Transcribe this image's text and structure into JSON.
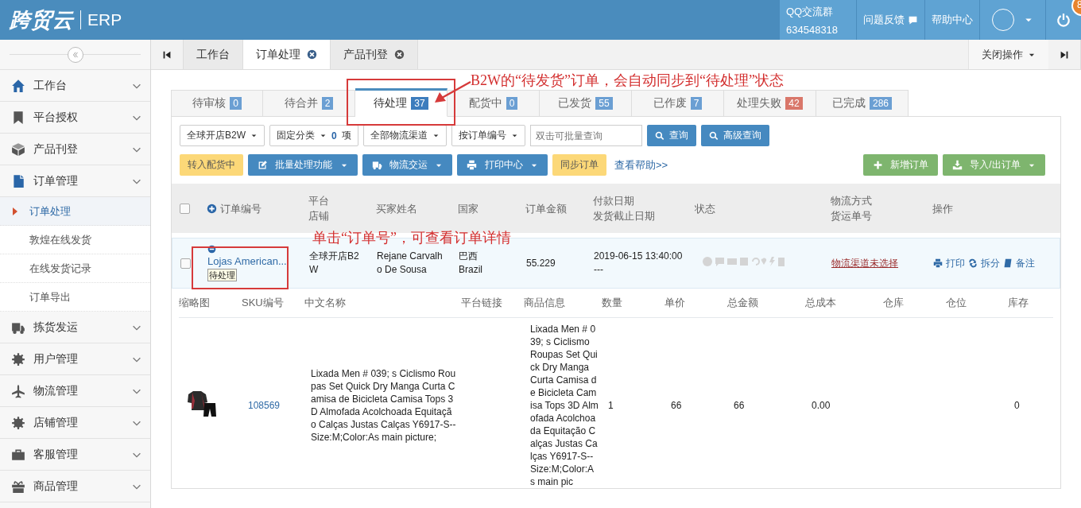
{
  "header": {
    "logo": "跨贸云",
    "product": "ERP",
    "qq_label": "QQ交流群",
    "qq_number": "634548318",
    "feedback": "问题反馈",
    "help": "帮助中心",
    "badge": "8"
  },
  "sidebar": {
    "items": [
      {
        "label": "工作台"
      },
      {
        "label": "平台授权"
      },
      {
        "label": "产品刊登"
      },
      {
        "label": "订单管理",
        "children": [
          {
            "label": "订单处理",
            "selected": true
          },
          {
            "label": "敦煌在线发货",
            "selected": false
          },
          {
            "label": "在线发货记录",
            "selected": false
          },
          {
            "label": "订单导出",
            "selected": false
          }
        ]
      },
      {
        "label": "拣货发运"
      },
      {
        "label": "用户管理"
      },
      {
        "label": "物流管理"
      },
      {
        "label": "店铺管理"
      },
      {
        "label": "客服管理"
      },
      {
        "label": "商品管理"
      }
    ]
  },
  "page_tabs": {
    "tabs": [
      {
        "label": "工作台",
        "selected": false,
        "closable": false
      },
      {
        "label": "订单处理",
        "selected": true,
        "closable": true
      },
      {
        "label": "产品刊登",
        "selected": false,
        "closable": true
      }
    ],
    "close_menu": "关闭操作"
  },
  "status_tabs": [
    {
      "label": "待审核",
      "count": "0",
      "selected": false,
      "color": "#6b9fd3"
    },
    {
      "label": "待合并",
      "count": "2",
      "selected": false,
      "color": "#6b9fd3"
    },
    {
      "label": "待处理",
      "count": "37",
      "selected": true,
      "color": "#3d7dbd"
    },
    {
      "label": "配货中",
      "count": "0",
      "selected": false,
      "color": "#6b9fd3"
    },
    {
      "label": "已发货",
      "count": "55",
      "selected": false,
      "color": "#6b9fd3"
    },
    {
      "label": "已作废",
      "count": "7",
      "selected": false,
      "color": "#6b9fd3"
    },
    {
      "label": "处理失败",
      "count": "42",
      "selected": false,
      "color": "#d9776a"
    },
    {
      "label": "已完成",
      "count": "286",
      "selected": false,
      "color": "#6b9fd3"
    }
  ],
  "filters": {
    "dropdowns": [
      {
        "label": "全球开店B2W"
      },
      {
        "label": "固定分类",
        "count": "0",
        "unit": "项"
      },
      {
        "label": "全部物流渠道"
      },
      {
        "label": "按订单编号"
      }
    ],
    "search_placeholder": "双击可批量查询",
    "search_button": "查询",
    "advanced_button": "高级查询"
  },
  "actions": [
    {
      "label": "转入配货中",
      "kind": "warning",
      "caret": false
    },
    {
      "label": "批量处理功能",
      "kind": "primary",
      "caret": true
    },
    {
      "label": "物流交运",
      "kind": "primary",
      "caret": true
    },
    {
      "label": "打印中心",
      "kind": "primary",
      "caret": true
    },
    {
      "label": "同步订单",
      "kind": "warning",
      "caret": false
    }
  ],
  "help_link": "查看帮助>>",
  "right_actions": [
    {
      "label": "新增订单",
      "kind": "success",
      "caret": false
    },
    {
      "label": "导入/出订单",
      "kind": "success",
      "caret": true
    }
  ],
  "order_table": {
    "all_checked": false,
    "columns": [
      [
        "订单编号"
      ],
      [
        "平台",
        "店铺"
      ],
      [
        "买家姓名"
      ],
      [
        "国家"
      ],
      [
        "订单金额"
      ],
      [
        "付款日期",
        "发货截止日期"
      ],
      [
        "状态"
      ],
      [
        "物流方式",
        "货运单号"
      ],
      [
        "操作"
      ]
    ],
    "orders": [
      {
        "checked": false,
        "order_no": "Lojas American...",
        "status_tag": "待处理",
        "store": "全球开店B2W",
        "buyer": "Rejane Carvalho De Sousa",
        "country_cn": "巴西",
        "country_en": "Brazil",
        "amount": "55.229",
        "pay_date": "2019-06-15 13:40:00",
        "deadline": "---",
        "logistics": "物流渠道未选择",
        "ops": [
          "打印",
          "拆分",
          "备注"
        ],
        "item_columns": [
          "缩略图",
          "SKU编号",
          "中文名称",
          "平台链接",
          "商品信息",
          "数量",
          "单价",
          "总金额",
          "总成本",
          "仓库",
          "仓位",
          "库存"
        ],
        "items": [
          {
            "sku": "108569",
            "name_cn": "Lixada Men # 039; s Ciclismo Roupas Set Quick Dry Manga Curta Camisa de Bicicleta Camisa Tops 3D Almofada Acolchoada Equitação Calças Justas Calças Y6917-S--Size:M;Color:As main picture;",
            "info": "Lixada Men # 039; s Ciclismo Roupas Set Quick Dry Manga Curta Camisa de Bicicleta Camisa Tops 3D Almofada Acolchoada Equitação Calças Justas Calças Y6917-S--Size:M;Color:As main pic",
            "qty": "1",
            "unit_price": "66",
            "total": "66",
            "cost": "0.00",
            "stock": "0"
          }
        ]
      }
    ]
  },
  "annotations": [
    {
      "text": "B2W的“待发货”订单，会自动同步到“待处理”状态"
    },
    {
      "text": "单击“订单号”，可查看订单详情"
    }
  ]
}
